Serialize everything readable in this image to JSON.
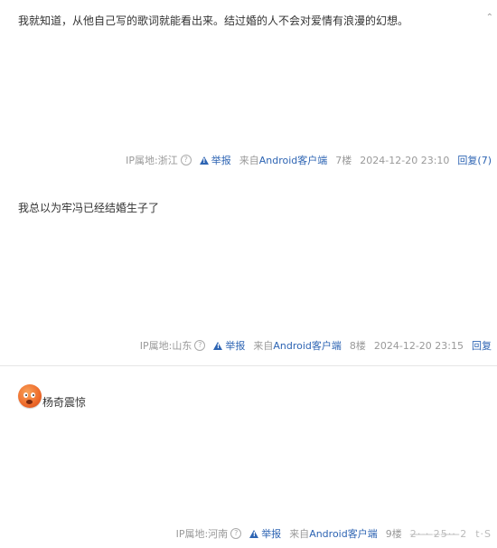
{
  "posts": [
    {
      "content": "我就知道，从他自己写的歌词就能看出来。结过婚的人不会对爱情有浪漫的幻想。",
      "ip": "IP属地:浙江",
      "report": "举报",
      "source_prefix": "来自",
      "source_client": "Android客户端",
      "floor": "7楼",
      "time": "2024-12-20 23:10",
      "reply": "回复(7)"
    },
    {
      "content": "我总以为牢冯已经结婚生子了",
      "ip": "IP属地:山东",
      "report": "举报",
      "source_prefix": "来自",
      "source_client": "Android客户端",
      "floor": "8楼",
      "time": "2024-12-20 23:15",
      "reply": "回复"
    },
    {
      "content": "杨奇震惊",
      "emoji": "surprised-face-emoji",
      "ip": "IP属地:河南",
      "report": "举报",
      "source_prefix": "来自",
      "source_client": "Android客户端",
      "floor": "9楼",
      "time": "2̶·̶ ̶·̶ ̶2̶5̶·̶·̶ ̶2",
      "reply": "t·S"
    }
  ],
  "icons": {
    "question": "?",
    "warning": "warning-triangle-icon",
    "corner": "⌃"
  },
  "colors": {
    "link": "#2d64b3",
    "meta": "#999999"
  }
}
